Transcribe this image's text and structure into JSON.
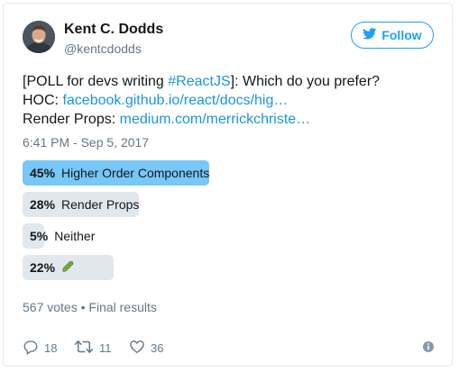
{
  "author": {
    "name": "Kent C. Dodds",
    "handle": "@kentcdodds"
  },
  "follow_button": {
    "label": "Follow",
    "icon": "twitter-bird-icon"
  },
  "tweet": {
    "line1_prefix": "[POLL for devs writing ",
    "hashtag": "#ReactJS",
    "line1_suffix": "]: Which do you prefer?",
    "hoc_label": "HOC: ",
    "hoc_link": "facebook.github.io/react/docs/hig…",
    "rp_label": "Render Props: ",
    "rp_link": "medium.com/merrickchriste…"
  },
  "timestamp": "6:41 PM - Sep 5, 2017",
  "poll": {
    "options": [
      {
        "percent": "45%",
        "value": 0.45,
        "label": "Higher Order Components",
        "winner": true
      },
      {
        "percent": "28%",
        "value": 0.28,
        "label": "Render Props",
        "winner": false
      },
      {
        "percent": "5%",
        "value": 0.05,
        "label": "Neither",
        "winner": false
      },
      {
        "percent": "22%",
        "value": 0.22,
        "label": "",
        "icon": "pickle-emoji",
        "winner": false
      }
    ],
    "votes": "567 votes",
    "separator": "•",
    "status": "Final results"
  },
  "actions": {
    "replies": "18",
    "retweets": "11",
    "likes": "36"
  },
  "colors": {
    "accent": "#1da1f2",
    "link": "#1b95e0",
    "winner_bar": "#77c7f7",
    "bar": "#e1e8ed",
    "muted": "#657786"
  }
}
